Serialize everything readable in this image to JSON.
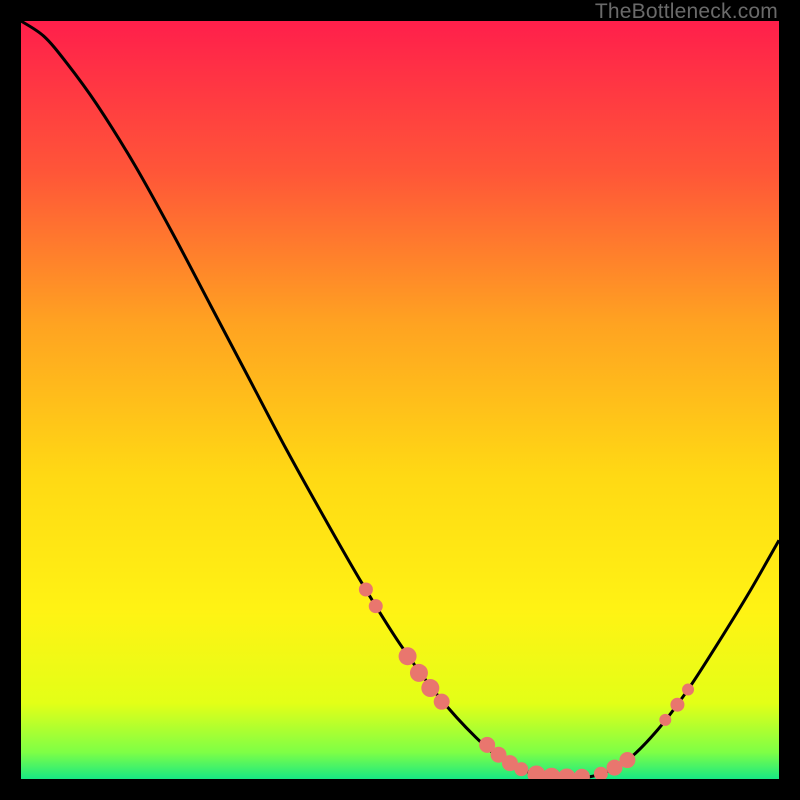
{
  "watermark": "TheBottleneck.com",
  "chart_data": {
    "type": "line",
    "title": "",
    "xlabel": "",
    "ylabel": "",
    "xlim": [
      0,
      1
    ],
    "ylim": [
      0,
      1
    ],
    "gradient_stops": [
      {
        "offset": 0.0,
        "color": "#ff1f4b"
      },
      {
        "offset": 0.2,
        "color": "#ff5638"
      },
      {
        "offset": 0.4,
        "color": "#ffa321"
      },
      {
        "offset": 0.6,
        "color": "#ffd914"
      },
      {
        "offset": 0.78,
        "color": "#fff314"
      },
      {
        "offset": 0.9,
        "color": "#e3ff17"
      },
      {
        "offset": 0.965,
        "color": "#7eff46"
      },
      {
        "offset": 1.0,
        "color": "#17e884"
      }
    ],
    "curve": [
      {
        "x": 0.0,
        "y": 1.0
      },
      {
        "x": 0.03,
        "y": 0.98
      },
      {
        "x": 0.06,
        "y": 0.945
      },
      {
        "x": 0.1,
        "y": 0.89
      },
      {
        "x": 0.15,
        "y": 0.81
      },
      {
        "x": 0.2,
        "y": 0.72
      },
      {
        "x": 0.25,
        "y": 0.625
      },
      {
        "x": 0.3,
        "y": 0.53
      },
      {
        "x": 0.35,
        "y": 0.435
      },
      {
        "x": 0.4,
        "y": 0.345
      },
      {
        "x": 0.45,
        "y": 0.258
      },
      {
        "x": 0.5,
        "y": 0.178
      },
      {
        "x": 0.55,
        "y": 0.11
      },
      {
        "x": 0.6,
        "y": 0.055
      },
      {
        "x": 0.64,
        "y": 0.022
      },
      {
        "x": 0.68,
        "y": 0.006
      },
      {
        "x": 0.72,
        "y": 0.002
      },
      {
        "x": 0.76,
        "y": 0.005
      },
      {
        "x": 0.8,
        "y": 0.025
      },
      {
        "x": 0.84,
        "y": 0.065
      },
      {
        "x": 0.88,
        "y": 0.118
      },
      {
        "x": 0.92,
        "y": 0.18
      },
      {
        "x": 0.96,
        "y": 0.245
      },
      {
        "x": 1.0,
        "y": 0.315
      }
    ],
    "markers": [
      {
        "x": 0.455,
        "y": 0.25,
        "r": 7
      },
      {
        "x": 0.468,
        "y": 0.228,
        "r": 7
      },
      {
        "x": 0.51,
        "y": 0.162,
        "r": 9
      },
      {
        "x": 0.525,
        "y": 0.14,
        "r": 9
      },
      {
        "x": 0.54,
        "y": 0.12,
        "r": 9
      },
      {
        "x": 0.555,
        "y": 0.102,
        "r": 8
      },
      {
        "x": 0.615,
        "y": 0.045,
        "r": 8
      },
      {
        "x": 0.63,
        "y": 0.032,
        "r": 8
      },
      {
        "x": 0.645,
        "y": 0.021,
        "r": 8
      },
      {
        "x": 0.66,
        "y": 0.013,
        "r": 7
      },
      {
        "x": 0.68,
        "y": 0.006,
        "r": 9
      },
      {
        "x": 0.7,
        "y": 0.003,
        "r": 9
      },
      {
        "x": 0.72,
        "y": 0.002,
        "r": 9
      },
      {
        "x": 0.74,
        "y": 0.003,
        "r": 8
      },
      {
        "x": 0.765,
        "y": 0.007,
        "r": 7
      },
      {
        "x": 0.783,
        "y": 0.015,
        "r": 8
      },
      {
        "x": 0.8,
        "y": 0.025,
        "r": 8
      },
      {
        "x": 0.85,
        "y": 0.078,
        "r": 6
      },
      {
        "x": 0.866,
        "y": 0.098,
        "r": 7
      },
      {
        "x": 0.88,
        "y": 0.118,
        "r": 6
      }
    ],
    "marker_color": "#e9766e"
  }
}
